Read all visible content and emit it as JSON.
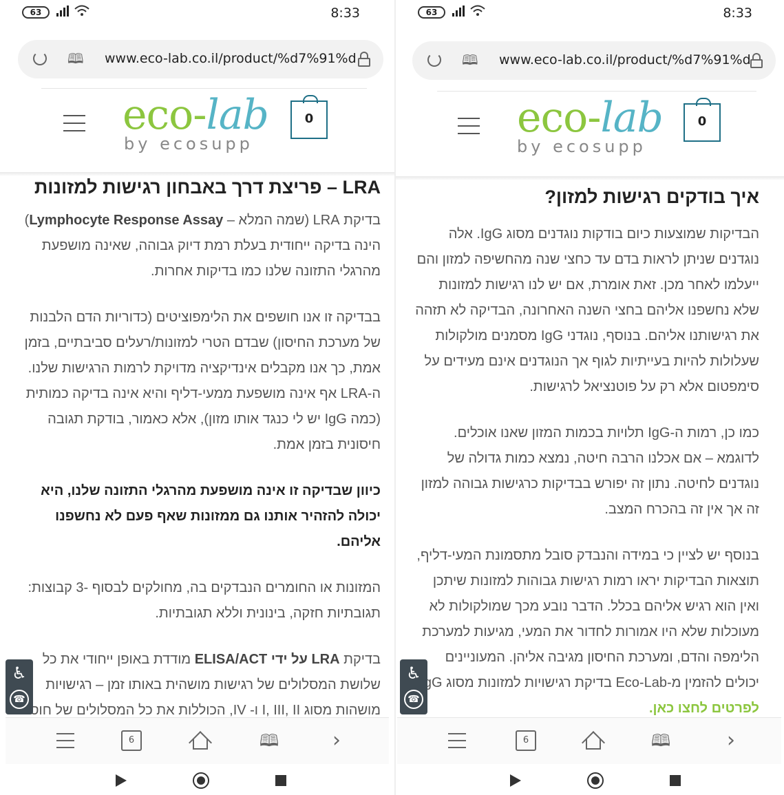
{
  "status": {
    "battery": "63",
    "time": "8:33"
  },
  "browser": {
    "url": "www.eco-lab.co.il/product/%d7%91%d",
    "tab_count": "6"
  },
  "site": {
    "logo_main_a": "eco-",
    "logo_main_b": "lab",
    "logo_sub": "by ecosupp",
    "cart_count": "0"
  },
  "left": {
    "heading": "LRA – פריצת דרך באבחון רגישות למזונות",
    "p1_pre": "בדיקת LRA (שמה המלא – ",
    "p1_en": "Lymphocyte Response Assay",
    "p1_post": ") הינה בדיקה ייחודית בעלת רמת דיוק גבוהה, שאינה מושפעת מהרגלי התזונה שלנו כמו בדיקות אחרות.",
    "p2": "בבדיקה זו אנו חושפים את הלימפוציטים (כדוריות הדם הלבנות של מערכת החיסון) שבדם הטרי למזונות/רעלים סביבתיים, בזמן אמת, כך אנו מקבלים אינדיקציה מדויקת לרמות הרגישות שלנו.",
    "p3": "ה-LRA אף אינה מושפעת ממעי-דליף והיא אינה בדיקה כמותית (כמה IgG יש לי כנגד אותו מזון), אלא כאמור, בודקת תגובה חיסונית בזמן אמת.",
    "p4": "כיוון שבדיקה זו אינה מושפעת מהרגלי התזונה שלנו, היא יכולה להזהיר אותנו גם ממזונות שאף פעם לא נחשפנו אליהם.",
    "p5": "המזונות או החומרים הנבדקים בה, מחולקים לבסוף -3 קבוצות: תגובתיות חזקה, בינונית וללא תגובתיות.",
    "p6_a": "בדיקת ",
    "p6_b": "LRA על ידי ELISA/ACT",
    "p6_c": " מודדת באופן ייחודי את כל שלושת המסלולים של רגישות מושהית באותו זמן – רגישויות מושהות מסוג I, III, II ו- IV, הכוללות את כל המסלולים של חוסר"
  },
  "right": {
    "heading": "איך בודקים רגישות למזון?",
    "p1": "הבדיקות שמוצעות כיום בודקות נוגדנים מסוג IgG. אלה נוגדנים שניתן לראות בדם עד כחצי שנה מהחשיפה למזון והם ייעלמו לאחר מכן. זאת אומרת, אם יש לנו רגישות למזונות שלא נחשפנו אליהם בחצי השנה האחרונה, הבדיקה לא תזהה את רגישותנו אליהם. בנוסף, נוגדני IgG מסמנים מולקולות שעלולות להיות בעייתיות לגוף אך הנוגדנים אינם מעידים על סימפטום אלא רק על פוטנציאל לרגישות.",
    "p2": "כמו כן, רמות ה-IgG תלויות בכמות המזון שאנו אוכלים. לדוגמא – אם אכלנו הרבה חיטה, נמצא כמות גדולה של נוגדנים לחיטה. נתון זה יפורש בבדיקות כרגישות גבוהה למזון זה אך אין זה בהכרח המצב.",
    "p3": "בנוסף יש לציין כי במידה והנבדק סובל מתסמונת המעי-דליף, תוצאות הבדיקות יראו רמות רגישות גבוהות למזונות שיתכן ואין הוא רגיש אליהם בכלל. הדבר נובע מכך שמולקולות לא מעוכלות שלא היו אמורות לחדור את המעי, מגיעות למערכת הלימפה והדם, ומערכת החיסון מגיבה אליהן. המעוניינים יכולים להזמין מ-Eco-Lab בדיקת רגישויות למזונות מסוג IgG.",
    "link": "לפרטים לחצו כאן."
  }
}
